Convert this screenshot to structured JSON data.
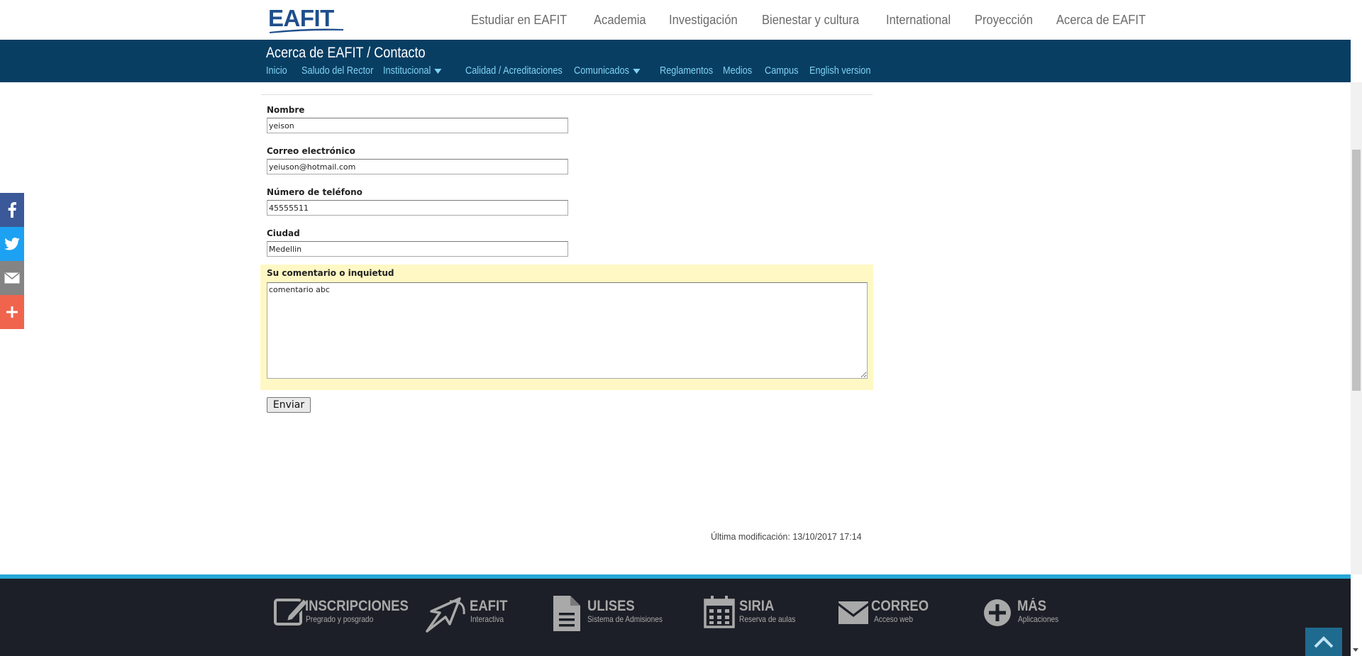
{
  "header": {
    "logo": "EAFIT",
    "nav": [
      "Estudiar en EAFIT",
      "Academia",
      "Investigación",
      "Bienestar y cultura",
      "International",
      "Proyección",
      "Acerca de EAFIT"
    ]
  },
  "section": {
    "title": "Acerca de EAFIT / Contacto",
    "subnav": {
      "inicio": "Inicio",
      "saludo": "Saludo del Rector",
      "institucional": "Institucional",
      "calidad": "Calidad / Acreditaciones",
      "comunicados": "Comunicados",
      "reglamentos": "Reglamentos",
      "medios": "Medios",
      "campus": "Campus",
      "english": "English version"
    }
  },
  "social": [
    "facebook-icon",
    "twitter-icon",
    "email-icon",
    "plus-icon"
  ],
  "form": {
    "nombre": {
      "label": "Nombre",
      "value": "yeison"
    },
    "correo": {
      "label": "Correo electrónico",
      "value": "yeiuson@hotmail.com"
    },
    "telefono": {
      "label": "Número de teléfono",
      "value": "45555511"
    },
    "ciudad": {
      "label": "Ciudad",
      "value": "Medellin"
    },
    "comentario": {
      "label": "Su comentario o inquietud",
      "value": "comentario abc"
    },
    "submit_label": "Enviar"
  },
  "last_modified": "Última modificación: 13/10/2017 17:14",
  "footer": {
    "apps": [
      {
        "title": "INSCRIPCIONES",
        "subtitle": "Pregrado y posgrado",
        "icon": "pencil-icon"
      },
      {
        "title": "EAFIT",
        "subtitle": "Interactiva",
        "icon": "cursor-icon"
      },
      {
        "title": "ULISES",
        "subtitle": "Sistema de Admisiones",
        "icon": "document-icon"
      },
      {
        "title": "SIRIA",
        "subtitle": "Reserva de aulas",
        "icon": "calendar-icon"
      },
      {
        "title": "CORREO",
        "subtitle": "Acceso web",
        "icon": "envelope-icon"
      },
      {
        "title": "MÁS",
        "subtitle": "Aplicaciones",
        "icon": "plus-circle-icon"
      }
    ]
  },
  "colors": {
    "section_bar": "#093e63",
    "subnav_link": "#7fd3f2",
    "footer_bg": "#1c1f27",
    "footer_accent": "#26a7d6",
    "comment_highlight": "#fff8c4"
  }
}
